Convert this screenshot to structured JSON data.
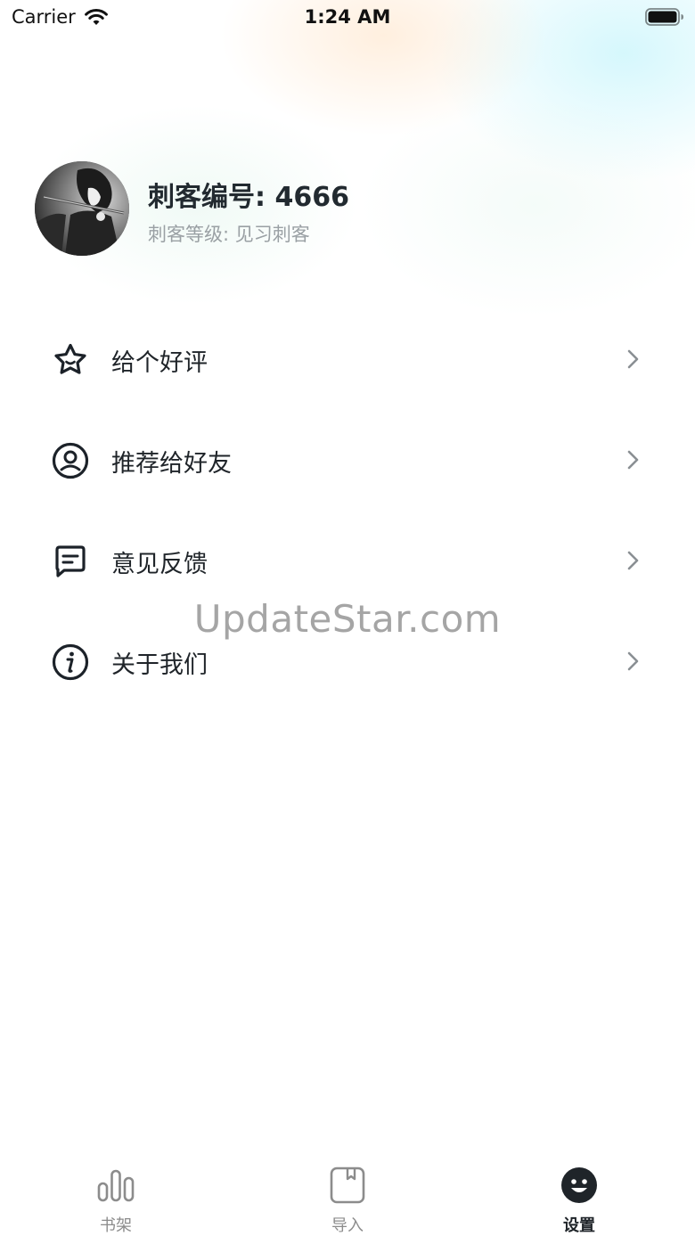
{
  "status_bar": {
    "carrier": "Carrier",
    "time": "1:24 AM",
    "icons": [
      "wifi-icon",
      "battery-icon"
    ]
  },
  "profile": {
    "name": "刺客编号: 4666",
    "level": "刺客等级: 见习刺客",
    "avatar": "avatar-image"
  },
  "menu": {
    "items": [
      {
        "label": "给个好评",
        "icon": "star-icon"
      },
      {
        "label": "推荐给好友",
        "icon": "user-circle-icon"
      },
      {
        "label": "意见反馈",
        "icon": "message-icon"
      },
      {
        "label": "关于我们",
        "icon": "info-icon"
      }
    ]
  },
  "watermark": "UpdateStar.com",
  "tab_bar": {
    "tabs": [
      {
        "label": "书架",
        "icon": "bookshelf-icon",
        "active": false
      },
      {
        "label": "导入",
        "icon": "import-icon",
        "active": false
      },
      {
        "label": "设置",
        "icon": "settings-smile-icon",
        "active": true
      }
    ]
  },
  "colors": {
    "text_primary": "#1f2429",
    "text_secondary": "#9aa0a4",
    "tab_inactive": "#8c8c8c",
    "chevron": "#8a8f93"
  }
}
